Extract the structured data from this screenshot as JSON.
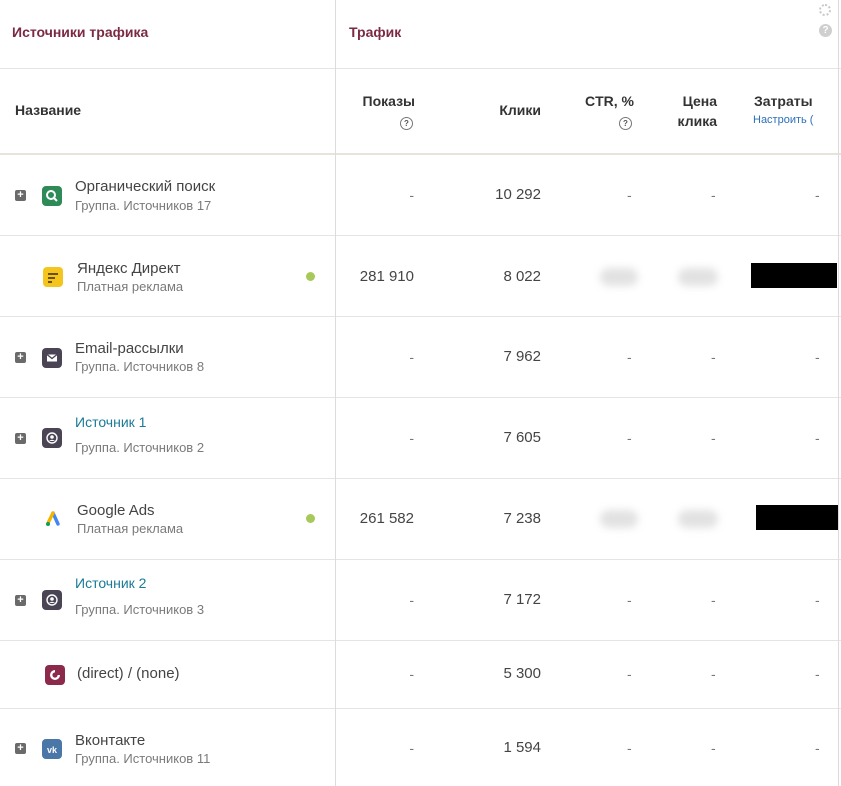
{
  "header": {
    "traffic_sources": "Источники трафика",
    "traffic": "Трафик",
    "help": "?"
  },
  "columns": {
    "name": "Название",
    "impressions": "Показы",
    "clicks": "Клики",
    "ctr": "CTR, %",
    "cpc_line1": "Цена",
    "cpc_line2": "клика",
    "cost": "Затраты",
    "configure": "Настроить (",
    "help": "?"
  },
  "rows": [
    {
      "name": "Органический поиск",
      "subtitle": "Группа. Источников 17",
      "impressions": "-",
      "clicks": "10 292",
      "ctr": "-",
      "cpc": "-",
      "cost": "-",
      "icon": "search-icon",
      "icon_color": "#2e8b57"
    },
    {
      "name": "Яндекс Директ",
      "subtitle": "Платная реклама",
      "impressions": "281 910",
      "clicks": "8 022",
      "icon": "yandex-direct-icon",
      "icon_color": "#f4c51f",
      "status_color": "#a8c85a"
    },
    {
      "name": "Email-рассылки",
      "subtitle": "Группа. Источников 8",
      "impressions": "-",
      "clicks": "7 962",
      "ctr": "-",
      "cpc": "-",
      "cost": "-",
      "icon": "mail-icon",
      "icon_color": "#4a4455"
    },
    {
      "name": "Источник 1",
      "subtitle": "Группа. Источников 2",
      "impressions": "-",
      "clicks": "7 605",
      "ctr": "-",
      "cpc": "-",
      "cost": "-",
      "icon": "user-icon",
      "icon_color": "#4a4455"
    },
    {
      "name": "Google Ads",
      "subtitle": "Платная реклама",
      "impressions": "261 582",
      "clicks": "7 238",
      "icon": "google-ads-icon",
      "icon_color": "#4285f4",
      "status_color": "#a8c85a"
    },
    {
      "name": "Источник 2",
      "subtitle": "Группа. Источников 3",
      "impressions": "-",
      "clicks": "7 172",
      "ctr": "-",
      "cpc": "-",
      "cost": "-",
      "icon": "user-icon",
      "icon_color": "#4a4455"
    },
    {
      "name": "(direct) / (none)",
      "impressions": "-",
      "clicks": "5 300",
      "ctr": "-",
      "cpc": "-",
      "cost": "-",
      "icon": "direct-icon",
      "icon_color": "#8b2a4a"
    },
    {
      "name": "Вконтакте",
      "subtitle": "Группа. Источников 11",
      "impressions": "-",
      "clicks": "1 594",
      "ctr": "-",
      "cpc": "-",
      "cost": "-",
      "icon": "vk-icon",
      "icon_color": "#4a76a8"
    }
  ]
}
